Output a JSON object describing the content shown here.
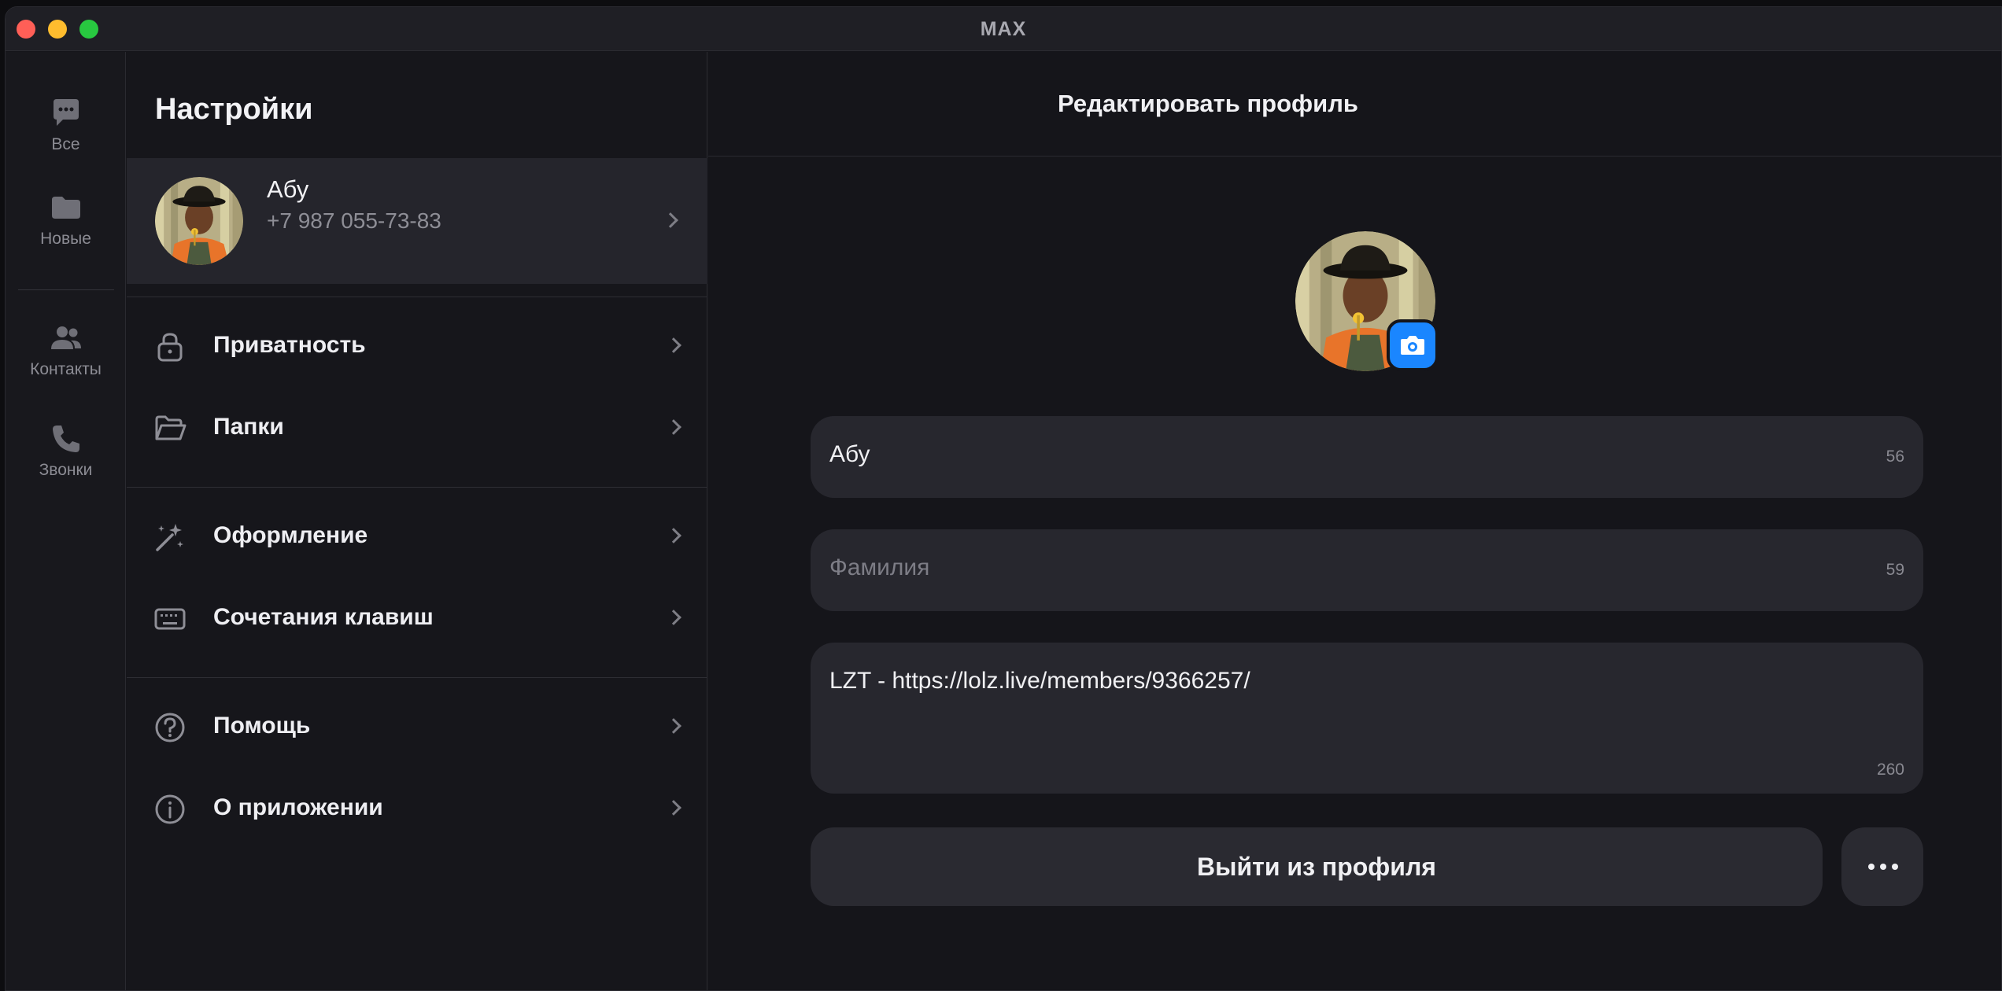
{
  "window": {
    "title": "MAX"
  },
  "rail": {
    "items": [
      {
        "label": "Все",
        "icon": "chat-bubble-icon"
      },
      {
        "label": "Новые",
        "icon": "folder-icon"
      },
      {
        "label": "Контакты",
        "icon": "contacts-icon"
      },
      {
        "label": "Звонки",
        "icon": "phone-icon"
      }
    ]
  },
  "settings": {
    "title": "Настройки",
    "profile": {
      "name": "Абу",
      "phone": "+7 987 055-73-83"
    },
    "menu": [
      {
        "label": "Приватность",
        "icon": "lock-icon"
      },
      {
        "label": "Папки",
        "icon": "folder-open-icon"
      },
      {
        "label": "Оформление",
        "icon": "magic-wand-icon"
      },
      {
        "label": "Сочетания клавиш",
        "icon": "keyboard-icon"
      },
      {
        "label": "Помощь",
        "icon": "help-icon"
      },
      {
        "label": "О приложении",
        "icon": "info-icon"
      }
    ]
  },
  "editor": {
    "title": "Редактировать профиль",
    "first_name": {
      "value": "Абу",
      "counter": "56"
    },
    "last_name": {
      "placeholder": "Фамилия",
      "counter": "59"
    },
    "bio": {
      "value": "LZT - https://lolz.live/members/9366257/",
      "counter": "260"
    },
    "logout_label": "Выйти из профиля"
  },
  "colors": {
    "accent": "#1a86ff",
    "background": "#15151a",
    "surface": "#27272e"
  }
}
